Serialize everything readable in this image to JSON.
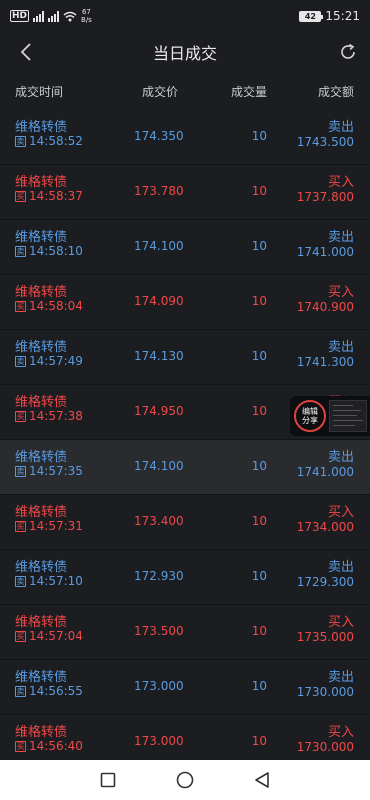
{
  "status_bar": {
    "hd": "HD",
    "net_tag": "4G",
    "speed_value": "67",
    "speed_unit": "B/s",
    "battery": "42",
    "time": "15:21"
  },
  "header": {
    "title": "当日成交",
    "back_icon": "chevron-left-icon",
    "refresh_icon": "refresh-icon"
  },
  "columns": {
    "time": "成交时间",
    "price": "成交价",
    "volume": "成交量",
    "amount": "成交额"
  },
  "colors": {
    "sell": "#5a9be0",
    "buy": "#f04848",
    "background": "#1c1d20",
    "highlight_row": "#2a2b2f"
  },
  "trades": [
    {
      "name": "维格转债",
      "icon": "卖",
      "time": "14:58:52",
      "price": "174.350",
      "volume": "10",
      "side": "卖出",
      "amount": "1743.500",
      "type": "sell"
    },
    {
      "name": "维格转债",
      "icon": "买",
      "time": "14:58:37",
      "price": "173.780",
      "volume": "10",
      "side": "买入",
      "amount": "1737.800",
      "type": "buy"
    },
    {
      "name": "维格转债",
      "icon": "卖",
      "time": "14:58:10",
      "price": "174.100",
      "volume": "10",
      "side": "卖出",
      "amount": "1741.000",
      "type": "sell"
    },
    {
      "name": "维格转债",
      "icon": "买",
      "time": "14:58:04",
      "price": "174.090",
      "volume": "10",
      "side": "买入",
      "amount": "1740.900",
      "type": "buy"
    },
    {
      "name": "维格转债",
      "icon": "卖",
      "time": "14:57:49",
      "price": "174.130",
      "volume": "10",
      "side": "卖出",
      "amount": "1741.300",
      "type": "sell"
    },
    {
      "name": "维格转债",
      "icon": "买",
      "time": "14:57:38",
      "price": "174.950",
      "volume": "10",
      "side": "买入",
      "amount": "",
      "type": "buy"
    },
    {
      "name": "维格转债",
      "icon": "卖",
      "time": "14:57:35",
      "price": "174.100",
      "volume": "10",
      "side": "卖出",
      "amount": "1741.000",
      "type": "sell"
    },
    {
      "name": "维格转债",
      "icon": "买",
      "time": "14:57:31",
      "price": "173.400",
      "volume": "10",
      "side": "买入",
      "amount": "1734.000",
      "type": "buy"
    },
    {
      "name": "维格转债",
      "icon": "卖",
      "time": "14:57:10",
      "price": "172.930",
      "volume": "10",
      "side": "卖出",
      "amount": "1729.300",
      "type": "sell"
    },
    {
      "name": "维格转债",
      "icon": "买",
      "time": "14:57:04",
      "price": "173.500",
      "volume": "10",
      "side": "买入",
      "amount": "1735.000",
      "type": "buy"
    },
    {
      "name": "维格转债",
      "icon": "卖",
      "time": "14:56:55",
      "price": "173.000",
      "volume": "10",
      "side": "卖出",
      "amount": "1730.000",
      "type": "sell"
    },
    {
      "name": "维格转债",
      "icon": "买",
      "time": "14:56:40",
      "price": "173.000",
      "volume": "10",
      "side": "买入",
      "amount": "1730.000",
      "type": "buy"
    }
  ],
  "float_widget": {
    "line1": "编辑",
    "line2": "分享"
  },
  "nav": {
    "recent_icon": "square-icon",
    "home_icon": "circle-icon",
    "back_icon": "triangle-back-icon"
  }
}
